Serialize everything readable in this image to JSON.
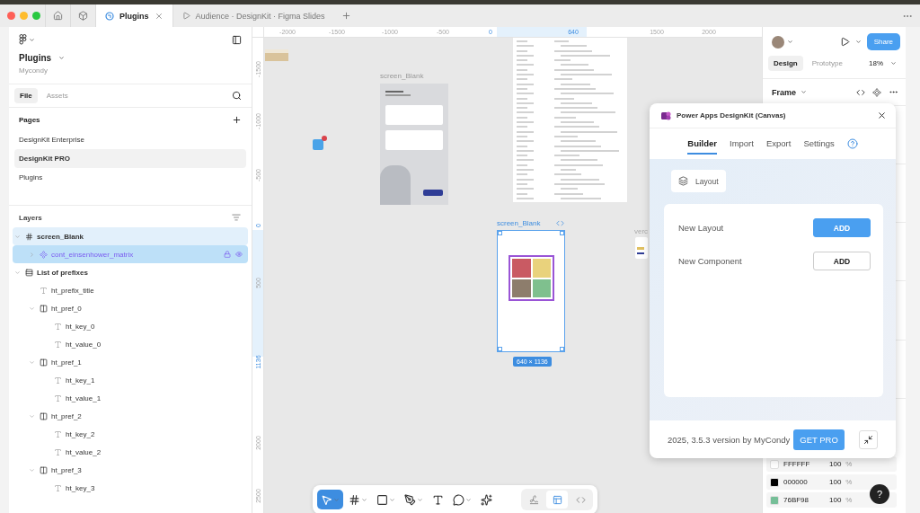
{
  "top_tabs": [
    {
      "label": "Plugins",
      "kind": "design",
      "selected": true
    },
    {
      "label": "Audience · DesignKit · Figma Slides",
      "kind": "slides",
      "selected": false
    }
  ],
  "left_panel": {
    "file_name": "Plugins",
    "team": "Mycondy",
    "tabs": [
      {
        "label": "File",
        "selected": true
      },
      {
        "label": "Assets",
        "selected": false
      }
    ],
    "pages_title": "Pages",
    "pages": [
      {
        "label": "DesignKit Enterprise",
        "selected": false
      },
      {
        "label": "DesignKit PRO",
        "selected": true
      },
      {
        "label": "Plugins",
        "selected": false
      }
    ],
    "layers_title": "Layers",
    "layers": [
      {
        "name": "screen_Blank",
        "kind": "frame",
        "expanded": true,
        "selected": false,
        "children": [
          {
            "name": "cont_einsenhower_matrix",
            "kind": "component",
            "expanded": false,
            "selected": true
          }
        ]
      },
      {
        "name": "List of prefixes",
        "kind": "autolayout_v",
        "expanded": true,
        "selected": false,
        "children": [
          {
            "name": "ht_prefix_title",
            "kind": "text",
            "selected": false
          },
          {
            "name": "ht_pref_0",
            "kind": "autolayout_h",
            "expanded": true,
            "selected": false,
            "children": [
              {
                "name": "ht_key_0",
                "kind": "text",
                "selected": false
              },
              {
                "name": "ht_value_0",
                "kind": "text",
                "selected": false
              }
            ]
          },
          {
            "name": "ht_pref_1",
            "kind": "autolayout_h",
            "expanded": true,
            "selected": false,
            "children": [
              {
                "name": "ht_key_1",
                "kind": "text",
                "selected": false
              },
              {
                "name": "ht_value_1",
                "kind": "text",
                "selected": false
              }
            ]
          },
          {
            "name": "ht_pref_2",
            "kind": "autolayout_h",
            "expanded": true,
            "selected": false,
            "children": [
              {
                "name": "ht_key_2",
                "kind": "text",
                "selected": false
              },
              {
                "name": "ht_value_2",
                "kind": "text",
                "selected": false
              }
            ]
          },
          {
            "name": "ht_pref_3",
            "kind": "autolayout_h",
            "expanded": true,
            "selected": false,
            "children": [
              {
                "name": "ht_key_3",
                "kind": "text",
                "selected": false
              }
            ]
          }
        ]
      }
    ]
  },
  "canvas": {
    "ruler_x": [
      {
        "label": "-2000",
        "highlighted": false
      },
      {
        "label": "-1500",
        "highlighted": false
      },
      {
        "label": "-1000",
        "highlighted": false
      },
      {
        "label": "-500",
        "highlighted": false
      },
      {
        "label": "0",
        "highlighted": true
      },
      {
        "label": "640",
        "highlighted": true
      },
      {
        "label": "1500",
        "highlighted": false
      },
      {
        "label": "2000",
        "highlighted": false
      }
    ],
    "ruler_y": [
      {
        "label": "-1500",
        "highlighted": false
      },
      {
        "label": "-1000",
        "highlighted": false
      },
      {
        "label": "-500",
        "highlighted": false
      },
      {
        "label": "0",
        "highlighted": true
      },
      {
        "label": "500",
        "highlighted": false
      },
      {
        "label": "1136",
        "highlighted": true
      },
      {
        "label": "2000",
        "highlighted": false
      },
      {
        "label": "2500",
        "highlighted": false
      }
    ],
    "mockup_title": "screen_Blank",
    "selected_frame": {
      "title": "screen_Blank",
      "size": "640 × 1136"
    },
    "partial_label": "verc"
  },
  "toolbar": {
    "tools": [
      {
        "kind": "move",
        "selected": true,
        "menu": true
      },
      {
        "kind": "frame",
        "selected": false,
        "menu": true
      },
      {
        "kind": "shape",
        "selected": false,
        "menu": true
      },
      {
        "kind": "pen",
        "selected": false,
        "menu": true
      },
      {
        "kind": "text",
        "selected": false,
        "menu": false
      },
      {
        "kind": "comment",
        "selected": false,
        "menu": true
      },
      {
        "kind": "actions",
        "selected": false,
        "menu": false
      }
    ],
    "modes": [
      {
        "kind": "draw",
        "selected": false
      },
      {
        "kind": "design",
        "selected": true
      },
      {
        "kind": "dev",
        "selected": false
      }
    ]
  },
  "right_panel": {
    "share": "Share",
    "tabs": [
      {
        "label": "Design",
        "selected": true
      },
      {
        "label": "Prototype",
        "selected": false
      }
    ],
    "zoom": "18%",
    "section": "Frame",
    "colors": [
      {
        "hex": "FFFFFF",
        "opacity": "100",
        "unit": "%",
        "color": "#ffffff"
      },
      {
        "hex": "000000",
        "opacity": "100",
        "unit": "%",
        "color": "#000000"
      },
      {
        "hex": "76BF98",
        "opacity": "100",
        "unit": "%",
        "color": "#76bf98"
      }
    ]
  },
  "help": "?",
  "plugin": {
    "title": "Power Apps DesignKit (Canvas)",
    "tabs": [
      {
        "label": "Builder",
        "selected": true
      },
      {
        "label": "Import",
        "selected": false
      },
      {
        "label": "Export",
        "selected": false
      },
      {
        "label": "Settings",
        "selected": false
      }
    ],
    "chip": "Layout",
    "actions": [
      {
        "label": "New Layout",
        "button": "ADD",
        "kind": "primary"
      },
      {
        "label": "New Component",
        "button": "ADD",
        "kind": "secondary"
      }
    ],
    "footer": "2025, 3.5.3 version by MyCondy",
    "pro": "GET PRO"
  }
}
